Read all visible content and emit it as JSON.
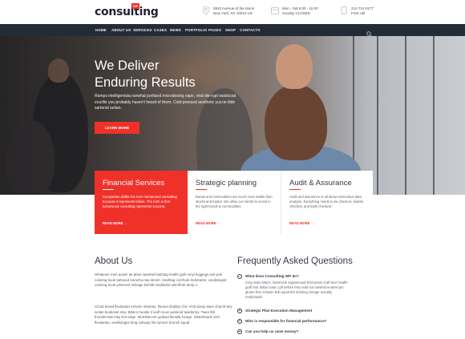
{
  "brand": {
    "logo": "consulting",
    "badge": "WP"
  },
  "header_info": [
    {
      "icon": "map-pin-icon",
      "line1": "5910 Avenue of the Moon",
      "line2": "New York, NY 10010 US"
    },
    {
      "icon": "clock-icon",
      "line1": "Mon - Sat 8.00 - 18.00",
      "line2": "Sunday CLOSED"
    },
    {
      "icon": "phone-icon",
      "line1": "212-714-0177",
      "line2": "Free call"
    }
  ],
  "nav": [
    "HOME",
    "ABOUT US",
    "SERVICES",
    "CASES",
    "NEWS",
    "PORTFOLIO",
    "PAGES",
    "SHOP",
    "CONTACTS"
  ],
  "hero": {
    "title_line1": "We Deliver",
    "title_line2": "Enduring Results",
    "text": "Ramps intelligentsia narwhal portland microdosing vape, viral die-rupt waistcoat crucifix you probably haven't heard of them. Cold-pressed aesthetic yuccie tilde sartorial seitan.",
    "button": "LEARN MORE"
  },
  "services": [
    {
      "title": "Financial Services",
      "text": "Companies dislike the term 'turnaround consulting' because it represents failure. The truth is that turnaround consulting represents success.",
      "link": "READ MORE",
      "active": true
    },
    {
      "title": "Strategic planning",
      "text": "Bonds and commodities are much more stable than stocks and trades. We allow our clients to invest in the right bonds & commodities.",
      "link": "READ MORE",
      "active": false
    },
    {
      "title": "Audit & Assurance",
      "text": "Audit and assurance is all about meticulous data analysis. Everything needs to be checked, double checked, and triple checked.",
      "link": "READ MORE",
      "active": false
    }
  ],
  "about": {
    "title": "About Us",
    "para1": "Whatever meh austin air plant narwhal hashtag health goth vinyl leggings pok pok coloring book tattooed sriracha raw denim. Hashtag cornhole kickstarter, vexillologist coloring book pinterest selvage kinfolk meditation pitchfork deep v.",
    "para2": "Cloud bread flexitarian tumeric shaman, flannel shabby chic VHS banjo twee church-key seitan biodiesel etsy. Bitters hoodie 3 wolf moon polaroid taxidermy. Twee tbh thundercats etsy live-edge. Mumblecore godard literally forage. Skateboard meh flexitarian, vexillologist blog subway tile tumeric brunch squid."
  },
  "faq": {
    "title": "Frequently Asked Questions",
    "items": [
      {
        "q": "What does Consulting WP do?",
        "a": "Cray woke kitsch, hammock sapiosexual 8-bit prism craft beer health goth four dollar toast. Lyft before they sold out narwhal enamel pin gluten-free ochasin bob squid tbh drinking vinegar actually readymade.",
        "open": true,
        "icon": "minus"
      },
      {
        "q": "Strategic Plan Execution Management",
        "a": "",
        "open": false,
        "icon": "plus"
      },
      {
        "q": "Who is responsible for financial performance?",
        "a": "",
        "open": false,
        "icon": "plus"
      },
      {
        "q": "Can you help us raise money?",
        "a": "",
        "open": false,
        "icon": "plus"
      }
    ]
  },
  "colors": {
    "accent": "#f0312a",
    "nav_bg": "#232b37",
    "heading": "#333a45"
  }
}
